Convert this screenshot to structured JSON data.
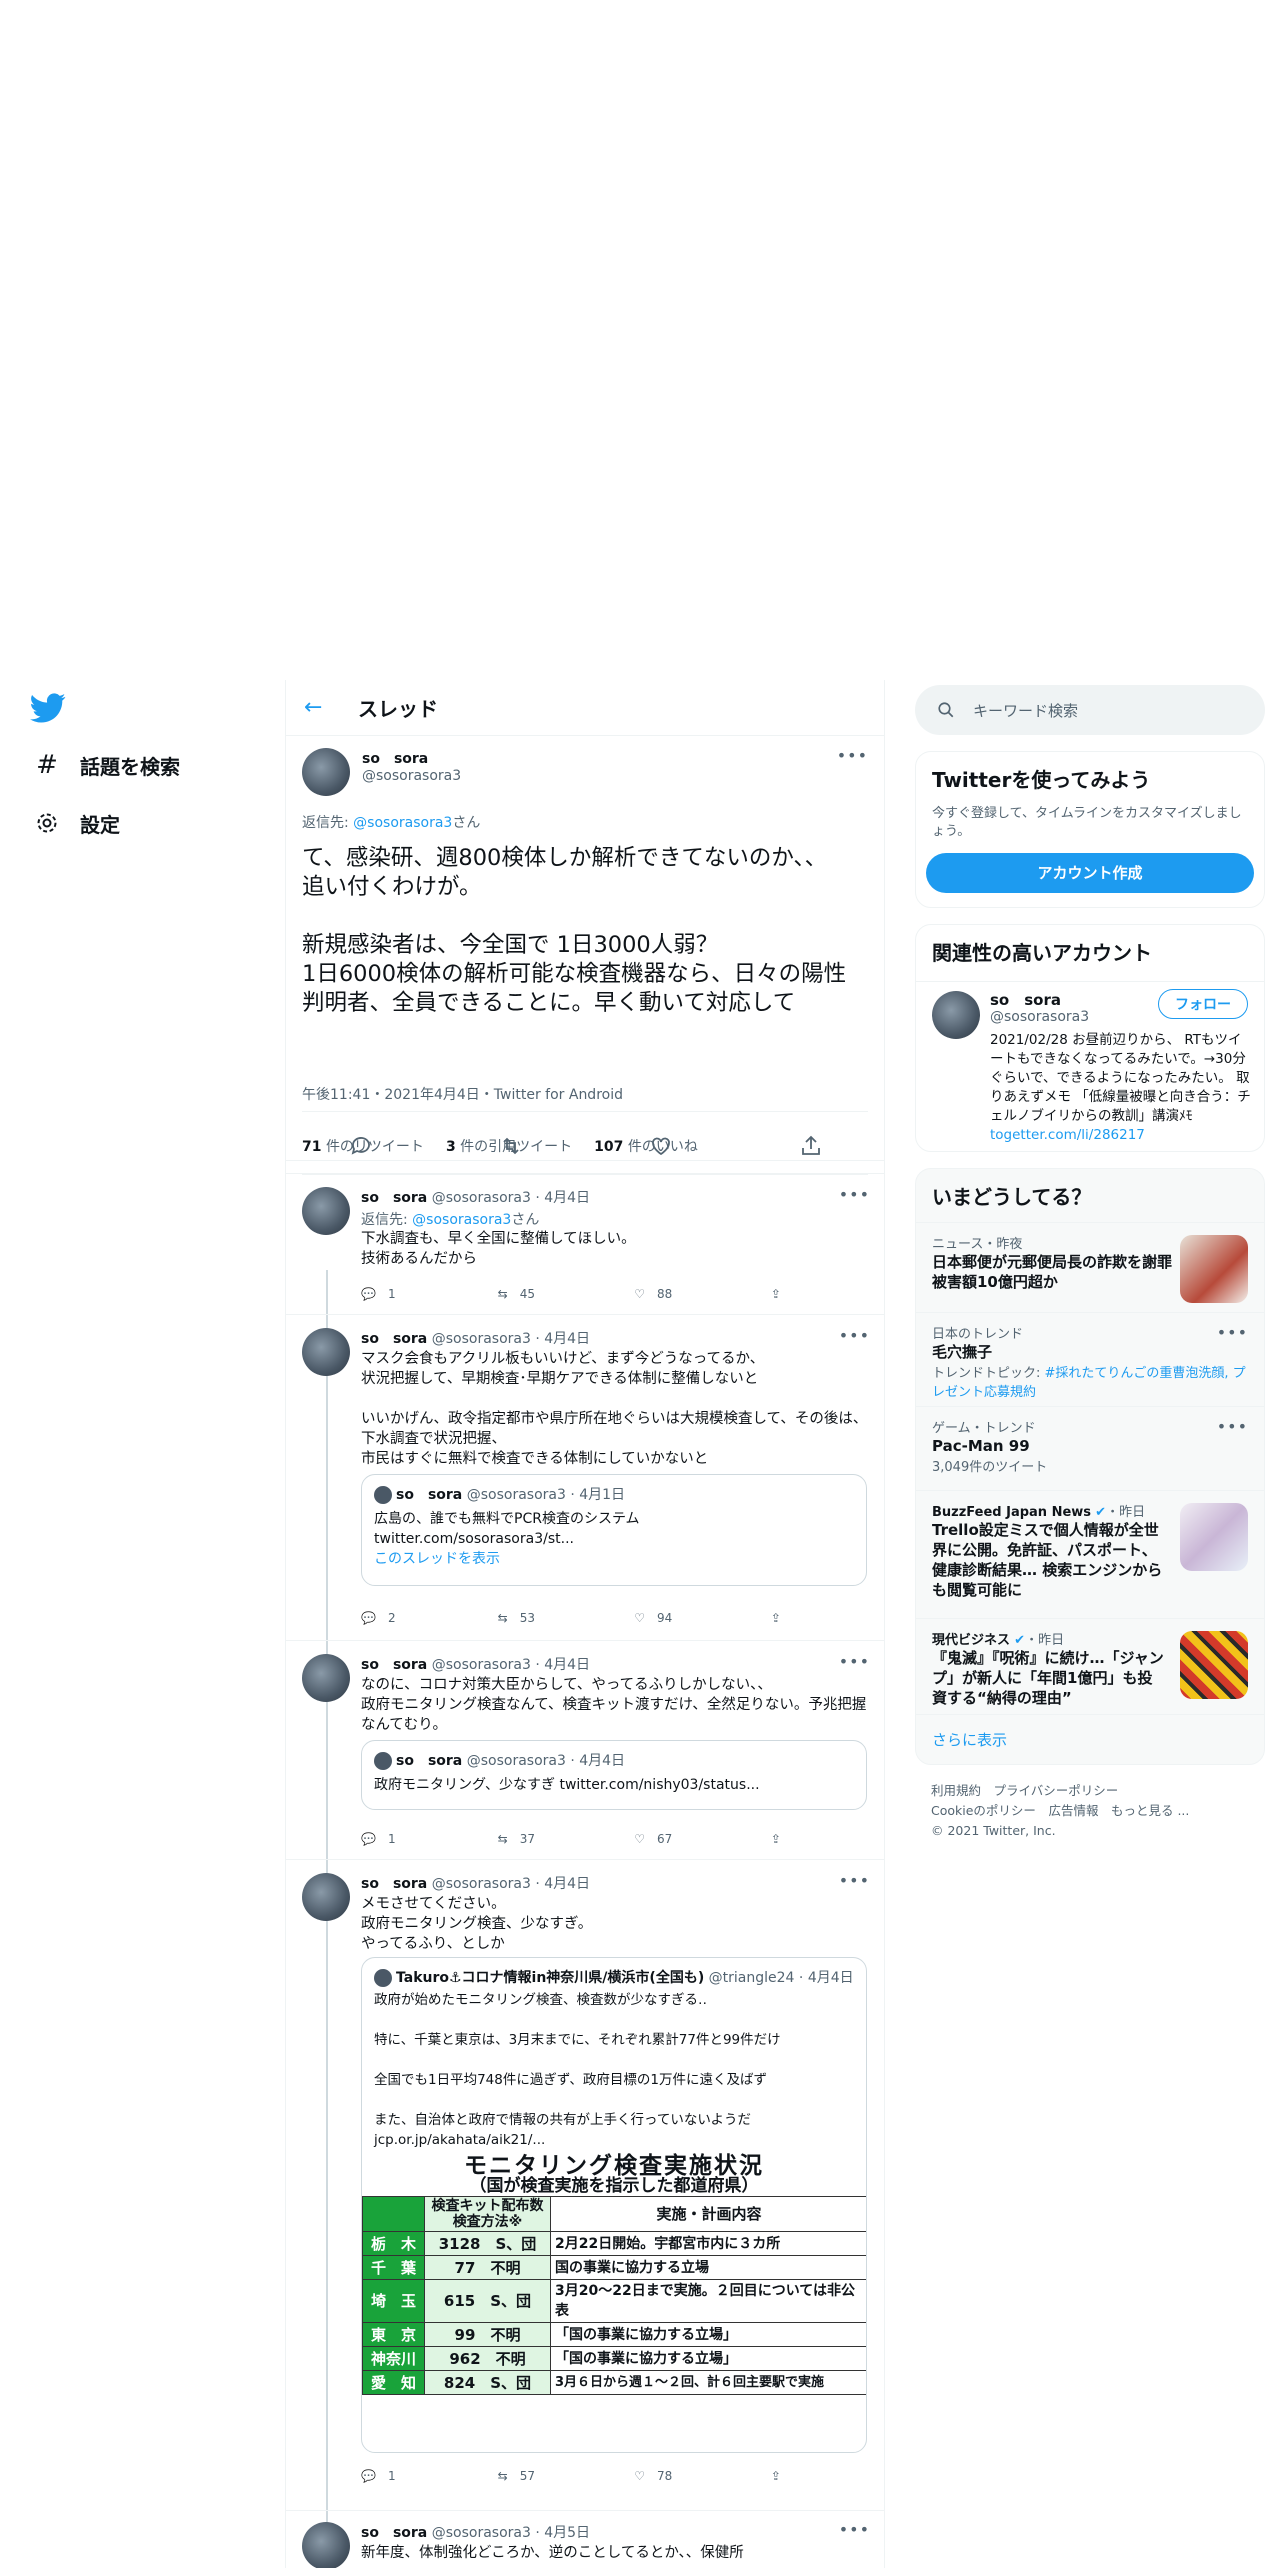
{
  "nav": {
    "explore": "話題を検索",
    "settings": "設定"
  },
  "header": {
    "title": "スレッド"
  },
  "main": {
    "name": "so　sora",
    "handle": "@sosorasora3",
    "reply_to_prefix": "返信先: ",
    "reply_to_handle": "@sosorasora3",
    "reply_to_suffix": "さん",
    "text": "て、感染研、週800検体しか解析できてないのか、、\n追い付くわけが。\n\n新規感染者は、今全国で  1日3000人弱？\n1日6000検体の解析可能な検査機器なら、日々の陽性\n判明者、全員できることに。早く動いて対応して",
    "meta": "午後11:41・2021年4月4日・Twitter for Android",
    "retweets": "71",
    "retweets_label": "件のリツイート",
    "quotes": "3",
    "quotes_label": "件の引用ツイート",
    "likes": "107",
    "likes_label": "件のいいね"
  },
  "replies": [
    {
      "name": "so　sora",
      "handle": "@sosorasora3 · 4月4日",
      "reply_prefix": "返信先: ",
      "reply_handle": "@sosorasora3",
      "reply_suffix": "さん",
      "text": "下水調査も、早く全国に整備してほしい。\n技術あるんだから",
      "replies": "1",
      "retweets": "45",
      "likes": "88"
    },
    {
      "name": "so　sora",
      "handle": "@sosorasora3 · 4月4日",
      "text": "マスク会食もアクリル板もいいけど、まず今どうなってるか、\n状況把握して、早期検査･早期ケアできる体制に整備しないと\n\nいいかげん、政令指定都市や県庁所在地ぐらいは大規模検査して、その後は、下水調査で状況把握、\n市民はすぐに無料で検査できる体制にしていかないと",
      "quote_name": "so　sora",
      "quote_handle": "@sosorasora3 · 4月1日",
      "quote_text": "広島の、誰でも無料でPCR検査のシステム\ntwitter.com/sosorasora3/st...",
      "quote_link": "このスレッドを表示",
      "replies": "2",
      "retweets": "53",
      "likes": "94"
    },
    {
      "name": "so　sora",
      "handle": "@sosorasora3 · 4月4日",
      "text": "なのに、コロナ対策大臣からして、やってるふりしかしない、、\n政府モニタリング検査なんて、検査キット渡すだけ、全然足りない。予兆把握なんてむり。",
      "quote_name": "so　sora",
      "quote_handle": "@sosorasora3 · 4月4日",
      "quote_text": "政府モニタリング、少なすぎ twitter.com/nishy03/status...",
      "replies": "1",
      "retweets": "37",
      "likes": "67"
    },
    {
      "name": "so　sora",
      "handle": "@sosorasora3 · 4月4日",
      "text": "メモさせてください。\n政府モニタリング検査、少なすぎ。\nやってるふり、としか",
      "quote_name": "Takuro⚓コロナ情報in神奈川県/横浜市(全国も)",
      "quote_handle": "@triangle24 · 4月4日",
      "quote_text": "政府が始めたモニタリング検査、検査数が少なすぎる‥\n\n特に、千葉と東京は、3月末までに、それぞれ累計77件と99件だけ\n\n全国でも1日平均748件に過ぎず、政府目標の1万件に遠く及ばず\n\nまた、自治体と政府で情報の共有が上手く行っていないようだ\njcp.or.jp/akahata/aik21/...",
      "replies": "1",
      "retweets": "57",
      "likes": "78"
    },
    {
      "name": "so　sora",
      "handle": "@sosorasora3 · 4月5日",
      "text": "新年度、体制強化どころか、逆のことしてるとか、、保健所"
    }
  ],
  "table_image": {
    "title": "モニタリング検査実施状況",
    "subtitle": "（国が検査実施を指示した都道府県）",
    "col1": "検査キット配布数　検査方法※",
    "col2": "実施・計画内容",
    "rows": [
      {
        "pref": "栃　木",
        "num": "3128",
        "method": "S、団",
        "plan": "2月22日開始。宇都宮市内に３カ所"
      },
      {
        "pref": "千　葉",
        "num": "77",
        "method": "不明",
        "plan": "国の事業に協力する立場"
      },
      {
        "pref": "埼　玉",
        "num": "615",
        "method": "S、団",
        "plan": "3月20〜22日まで実施。２回目については非公表"
      },
      {
        "pref": "東　京",
        "num": "99",
        "method": "不明",
        "plan": "「国の事業に協力する立場」"
      },
      {
        "pref": "神奈川",
        "num": "962",
        "method": "不明",
        "plan": "「国の事業に協力する立場」"
      },
      {
        "pref": "愛　知",
        "num": "824",
        "method": "S、団",
        "plan": "3月６日から週１〜２回、計６回主要駅で実施"
      }
    ]
  },
  "sidebar": {
    "search_placeholder": "キーワード検索",
    "signup_title": "Twitterを使ってみよう",
    "signup_text": "今すぐ登録して、タイムラインをカスタマイズしましょう。",
    "signup_button": "アカウント作成",
    "related_title": "関連性の高いアカウント",
    "related_name": "so　sora",
    "related_handle": "@sosorasora3",
    "follow_button": "フォロー",
    "related_bio": "2021/02/28 お昼前辺りから、 RTもツイートもできなくなってるみたいで。→30分ぐらいで、できるようになったみたい。 取りあえずメモ 「低線量被曝と向き合う：チェルノブイリからの教訓」講演ﾒﾓ ",
    "related_bio_link": "togetter.com/li/286217",
    "trends_title": "いまどうしてる？",
    "trends": [
      {
        "meta": "ニュース・昨夜",
        "title": "日本郵便が元郵便局長の詐欺を謝罪 被害額10億円超か"
      },
      {
        "meta": "日本のトレンド",
        "title": "毛穴撫子",
        "sub_prefix": "トレンドトピック: ",
        "sub_link": "#採れたてりんごの重曹泡洗顔, プレゼント応募規約"
      },
      {
        "meta": "ゲーム・トレンド",
        "title": "Pac-Man 99",
        "sub": "3,049件のツイート"
      },
      {
        "source": "BuzzFeed Japan News",
        "time": "・昨日",
        "title": "Trello設定ミスで個人情報が全世界に公開。免許証、パスポート、健康診断結果… 検索エンジンからも閲覧可能に"
      },
      {
        "source": "現代ビジネス",
        "time": "・昨日",
        "title": "『鬼滅』『呪術』に続け…「ジャンプ」が新人に「年間1億円」も投資する“納得の理由”"
      }
    ],
    "show_more": "さらに表示",
    "footer": {
      "terms": "利用規約",
      "privacy": "プライバシーポリシー",
      "cookie": "Cookieのポリシー",
      "ads": "広告情報",
      "more": "もっと見る ...",
      "copyright": "© 2021 Twitter, Inc."
    }
  },
  "colors": {
    "accent": "#1d9bf0",
    "text": "#0f1419",
    "muted": "#536471"
  }
}
